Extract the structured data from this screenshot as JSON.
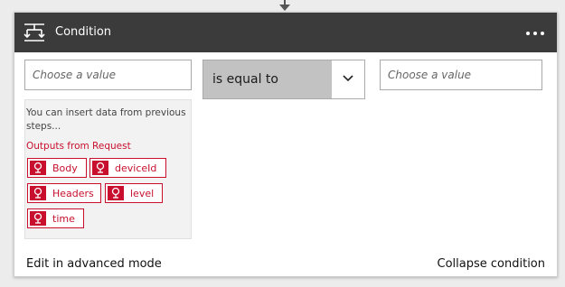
{
  "header": {
    "title": "Condition",
    "icon": "condition-icon",
    "more_icon": "more-options-icon"
  },
  "condition": {
    "left_placeholder": "Choose a value",
    "operator": "is equal to",
    "right_placeholder": "Choose a value"
  },
  "dynamic_content": {
    "hint": "You can insert data from previous steps...",
    "outputs_title": "Outputs from Request",
    "tokens": [
      "Body",
      "deviceId",
      "Headers",
      "level",
      "time"
    ]
  },
  "footer": {
    "advanced_label": "Edit in advanced mode",
    "collapse_label": "Collapse condition"
  },
  "colors": {
    "header_bg": "#3b3b3b",
    "token_red": "#c8102e",
    "operator_bg": "#c2c2c2"
  }
}
